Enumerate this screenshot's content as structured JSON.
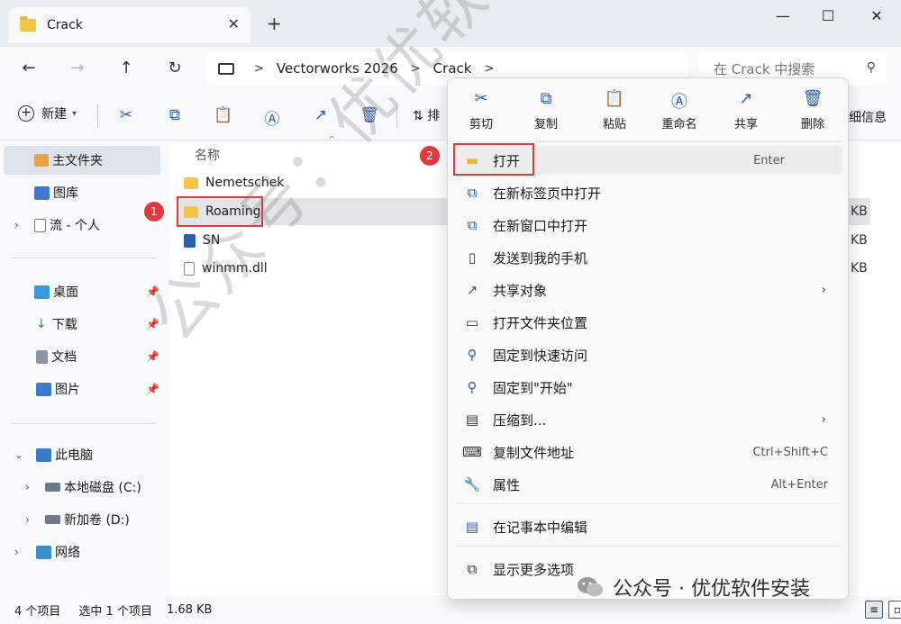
{
  "window": {
    "tab_title": "Crack",
    "tab_close": "✕",
    "new_tab": "+",
    "minimize": "—",
    "maximize": "☐",
    "close": "✕"
  },
  "nav": {
    "back": "←",
    "forward": "→",
    "up": "↑",
    "refresh": "↻",
    "breadcrumb": [
      "Vectorworks 2026",
      "Crack"
    ],
    "search_placeholder": "在 Crack 中搜索"
  },
  "toolbar": {
    "new_label": "新建",
    "sort_label": "排",
    "details_label": "细信息"
  },
  "sidebar": {
    "home": "主文件夹",
    "gallery": "图库",
    "personal": "流 - 个人",
    "desktop": "桌面",
    "downloads": "下载",
    "documents": "文档",
    "pictures": "图片",
    "this_pc": "此电脑",
    "drive_c": "本地磁盘 (C:)",
    "drive_d": "新加卷 (D:)",
    "network": "网络"
  },
  "content": {
    "col_name": "名称",
    "files": [
      {
        "name": "Nemetschek",
        "size": ""
      },
      {
        "name": "Roaming",
        "size": "KB"
      },
      {
        "name": "SN",
        "size": "KB"
      },
      {
        "name": "winmm.dll",
        "size": "KB"
      }
    ],
    "badge1": "1",
    "badge2": "2"
  },
  "context_menu": {
    "quick_actions": [
      "剪切",
      "复制",
      "粘贴",
      "重命名",
      "共享",
      "删除"
    ],
    "items": [
      {
        "label": "打开",
        "shortcut": "Enter"
      },
      {
        "label": "在新标签页中打开",
        "shortcut": ""
      },
      {
        "label": "在新窗口中打开",
        "shortcut": ""
      },
      {
        "label": "发送到我的手机",
        "shortcut": ""
      },
      {
        "label": "共享对象",
        "shortcut": ""
      },
      {
        "label": "打开文件夹位置",
        "shortcut": ""
      },
      {
        "label": "固定到快速访问",
        "shortcut": ""
      },
      {
        "label": "固定到\"开始\"",
        "shortcut": ""
      },
      {
        "label": "压缩到...",
        "shortcut": ""
      },
      {
        "label": "复制文件地址",
        "shortcut": "Ctrl+Shift+C"
      },
      {
        "label": "属性",
        "shortcut": "Alt+Enter"
      },
      {
        "label": "在记事本中编辑",
        "shortcut": ""
      },
      {
        "label": "显示更多选项",
        "shortcut": ""
      }
    ]
  },
  "status": {
    "count": "4 个项目",
    "selected": "选中 1 个项目",
    "size": "1.68 KB"
  },
  "watermark": {
    "diagonal": "公众号：优优软件安装",
    "footer": "公众号 · 优优软件安装"
  },
  "colors": {
    "accent": "#2b5fa8",
    "highlight_box": "#e0393e",
    "folder": "#f4c542"
  }
}
